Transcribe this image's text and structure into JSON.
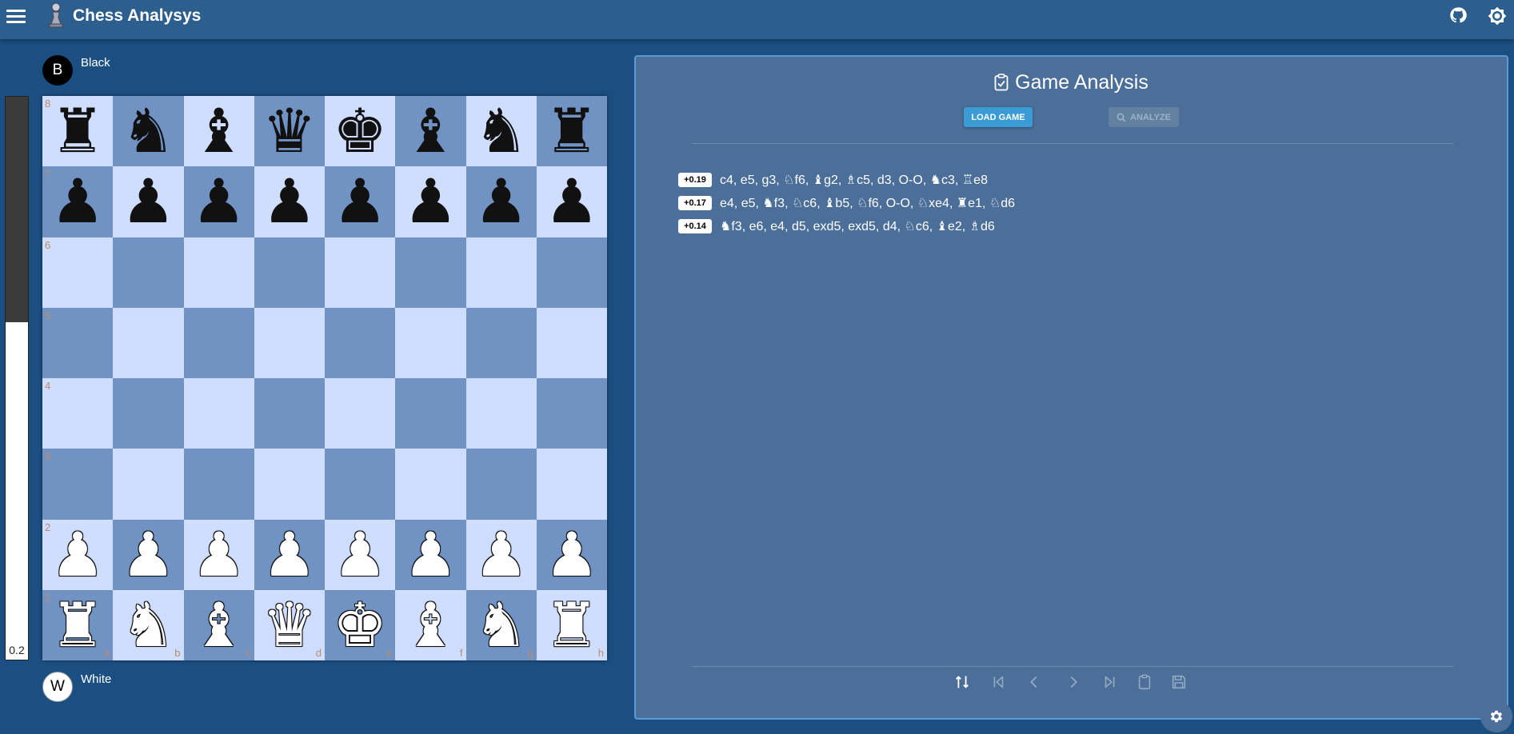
{
  "app": {
    "title": "Chess Analysys"
  },
  "players": {
    "top": {
      "initial": "B",
      "name": "Black"
    },
    "bottom": {
      "initial": "W",
      "name": "White"
    }
  },
  "evaluation": {
    "label": "0.2",
    "white_fraction": 0.6
  },
  "board": {
    "ranks": [
      "8",
      "7",
      "6",
      "5",
      "4",
      "3",
      "2",
      "1"
    ],
    "files": [
      "a",
      "b",
      "c",
      "d",
      "e",
      "f",
      "g",
      "h"
    ],
    "position": [
      [
        "r",
        "n",
        "b",
        "q",
        "k",
        "b",
        "n",
        "r"
      ],
      [
        "p",
        "p",
        "p",
        "p",
        "p",
        "p",
        "p",
        "p"
      ],
      [
        "",
        "",
        "",
        "",
        "",
        "",
        "",
        ""
      ],
      [
        "",
        "",
        "",
        "",
        "",
        "",
        "",
        ""
      ],
      [
        "",
        "",
        "",
        "",
        "",
        "",
        "",
        ""
      ],
      [
        "",
        "",
        "",
        "",
        "",
        "",
        "",
        ""
      ],
      [
        "P",
        "P",
        "P",
        "P",
        "P",
        "P",
        "P",
        "P"
      ],
      [
        "R",
        "N",
        "B",
        "Q",
        "K",
        "B",
        "N",
        "R"
      ]
    ],
    "colors": {
      "light": "#cfddff",
      "dark": "#7093c4"
    }
  },
  "panel": {
    "title": "Game Analysis",
    "load_label": "LOAD GAME",
    "analyze_label": "ANALYZE"
  },
  "lines": [
    {
      "score": "+0.19",
      "moves": "c4, e5, g3, ♘f6, ♝g2, ♗c5, d3, O-O, ♞c3, ♖e8"
    },
    {
      "score": "+0.17",
      "moves": "e4, e5, ♞f3, ♘c6, ♝b5, ♘f6, O-O, ♘xe4, ♜e1, ♘d6"
    },
    {
      "score": "+0.14",
      "moves": "♞f3, e6, e4, d5, exd5, exd5, d4, ♘c6, ♝e2, ♗d6"
    }
  ],
  "nav": {
    "icons": [
      "flip-board-icon",
      "first-move-icon",
      "previous-move-icon",
      "next-move-icon",
      "last-move-icon",
      "clipboard-icon",
      "save-icon"
    ]
  },
  "theme": {
    "background": "#1b4f82",
    "appbar": "#2d5f8e",
    "panel": "#4b6f99",
    "accent": "#3a9bd5"
  }
}
